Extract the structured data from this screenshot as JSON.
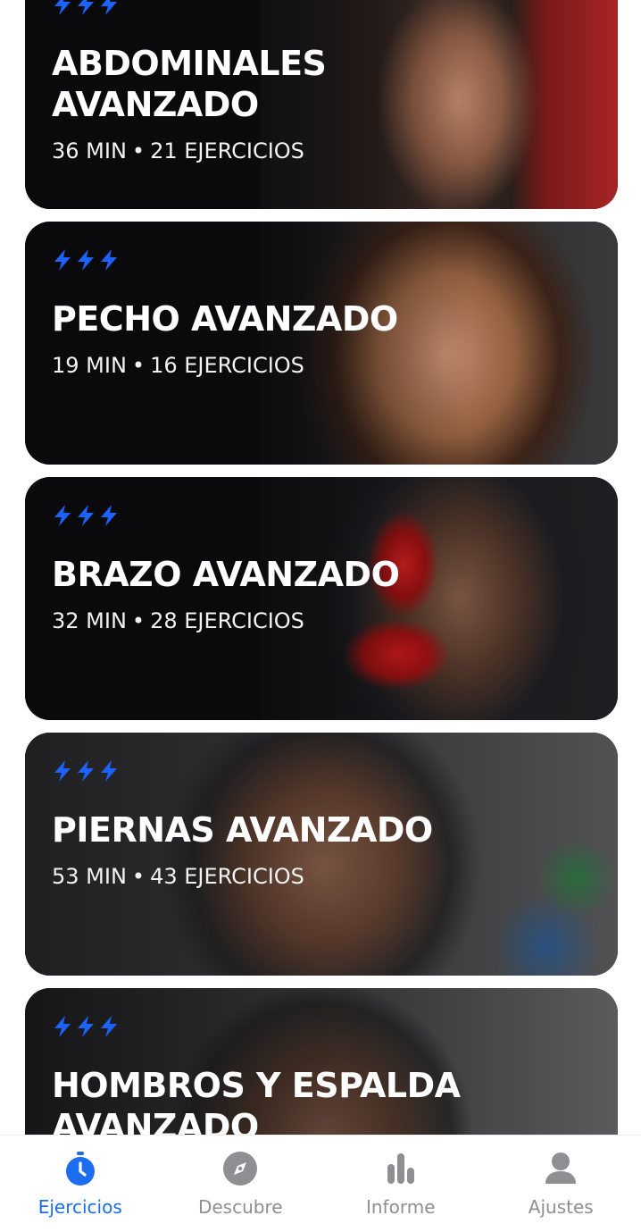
{
  "colors": {
    "accent": "#1d6df0",
    "bolt": "#1c62ff",
    "inactive": "#8e8e93",
    "card_bg": "#0c0c0e"
  },
  "workouts": [
    {
      "title_line1": "ABDOMINALES",
      "title_line2": "AVANZADO",
      "minutes": "36 MIN",
      "exercises": "21 EJERCICIOS"
    },
    {
      "title_line1": "PECHO AVANZADO",
      "title_line2": "",
      "minutes": "19 MIN",
      "exercises": "16 EJERCICIOS"
    },
    {
      "title_line1": "BRAZO AVANZADO",
      "title_line2": "",
      "minutes": "32 MIN",
      "exercises": "28 EJERCICIOS"
    },
    {
      "title_line1": "PIERNAS AVANZADO",
      "title_line2": "",
      "minutes": "53 MIN",
      "exercises": "43 EJERCICIOS"
    },
    {
      "title_line1": "HOMBROS Y ESPALDA",
      "title_line2": "AVANZADO",
      "minutes": "",
      "exercises": ""
    }
  ],
  "separator": "•",
  "nav": {
    "items": [
      {
        "label": "Ejercicios",
        "icon": "stopwatch-icon",
        "active": true
      },
      {
        "label": "Descubre",
        "icon": "compass-icon",
        "active": false
      },
      {
        "label": "Informe",
        "icon": "bar-chart-icon",
        "active": false
      },
      {
        "label": "Ajustes",
        "icon": "user-icon",
        "active": false
      }
    ]
  }
}
